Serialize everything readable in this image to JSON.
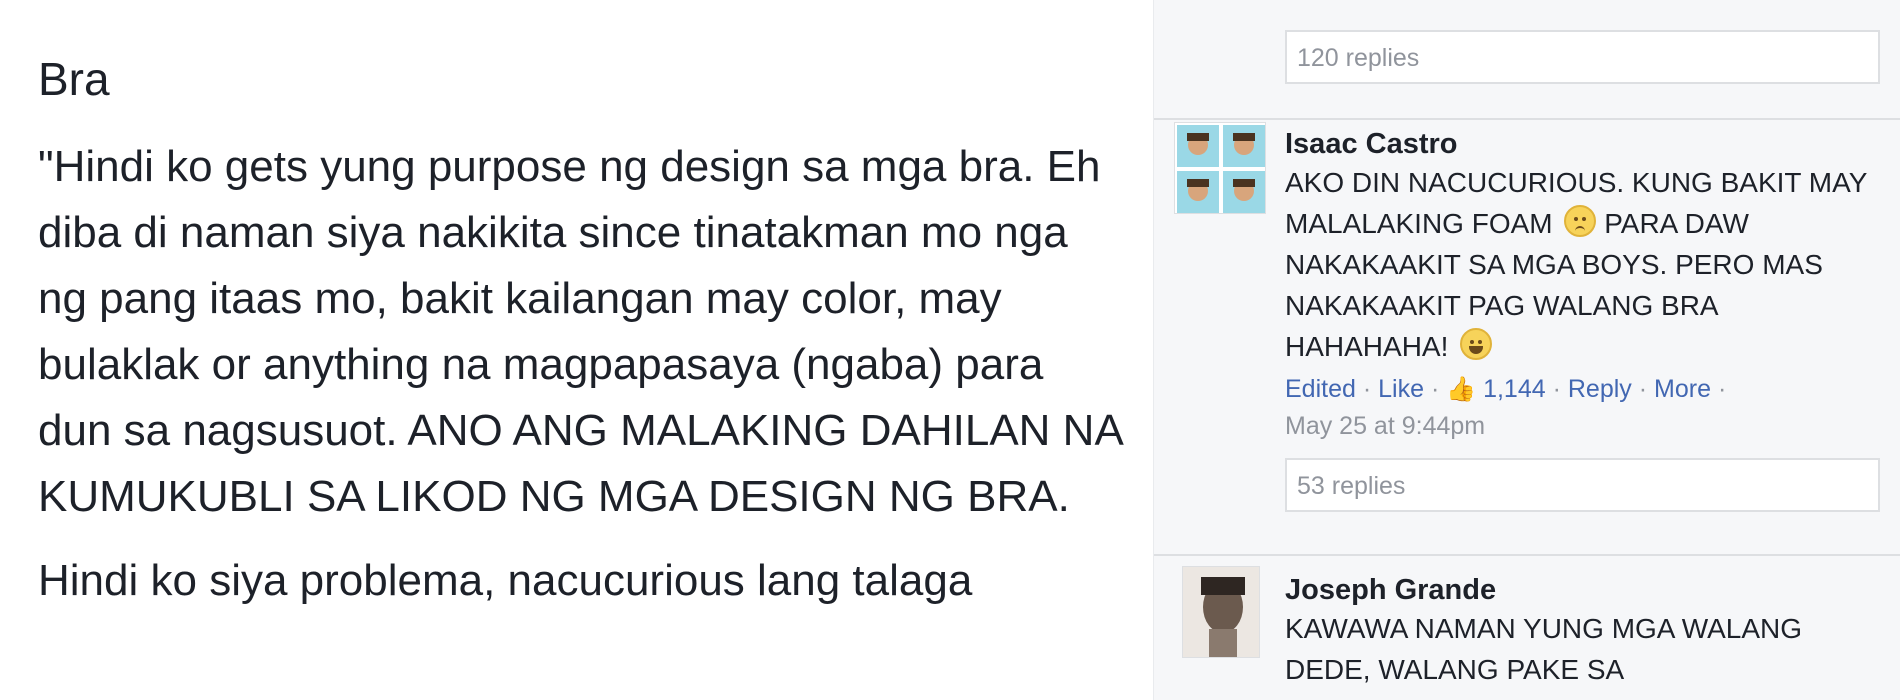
{
  "post": {
    "title": "Bra",
    "paragraph_1": "\"Hindi ko gets yung purpose ng design sa mga bra. Eh diba di naman siya nakikita since tinatakman mo nga ng pang itaas mo, bakit kailangan may color, may bulaklak or anything na magpapasaya (ngaba) para dun sa nagsusuot. ANO ANG MALAKING DAHILAN NA KUMUKUBLI SA LIKOD NG MGA DESIGN NG BRA.",
    "paragraph_2": "Hindi ko siya problema, nacucurious lang talaga"
  },
  "comments": {
    "top_replies": "120 replies",
    "items": [
      {
        "author": "Isaac Castro",
        "text_part1": "AKO DIN NACUCURIOUS. KUNG BAKIT MAY MALALAKING FOAM",
        "text_part2": "PARA DAW NAKAKAAKIT SA MGA BOYS. PERO MAS NAKAKAAKIT PAG WALANG BRA HAHAHAHA!",
        "edited": "Edited",
        "like": "Like",
        "like_count": "1,144",
        "reply": "Reply",
        "more": "More",
        "date": "May 25 at 9:44pm",
        "replies": "53 replies"
      },
      {
        "author": "Joseph Grande",
        "text": "KAWAWA NAMAN YUNG MGA WALANG DEDE, WALANG PAKE SA"
      }
    ]
  },
  "icons": {
    "sad_emoji": "sad-face-emoji",
    "laugh_emoji": "laughing-face-emoji",
    "like_icon": "thumbs-up-icon"
  }
}
